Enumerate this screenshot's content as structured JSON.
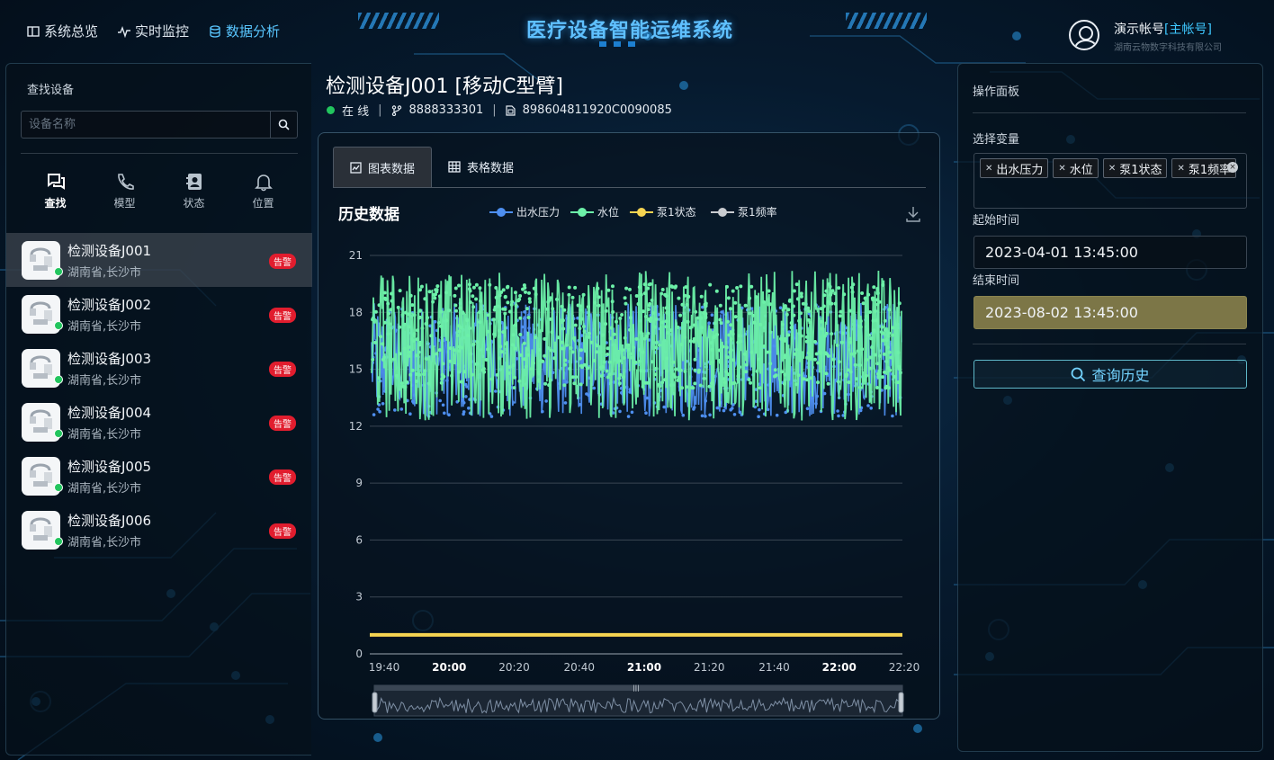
{
  "header": {
    "nav": [
      {
        "label": "系统总览",
        "icon": "layout-icon"
      },
      {
        "label": "实时监控",
        "icon": "pulse-icon"
      },
      {
        "label": "数据分析",
        "icon": "database-icon"
      }
    ],
    "app_title": "医疗设备智能运维系统",
    "user": {
      "name": "演示帐号",
      "role": "[主帐号]",
      "org": "湖南云物数字科技有限公司"
    }
  },
  "sidebar": {
    "title": "查找设备",
    "search_placeholder": "设备名称",
    "modes": [
      {
        "label": "查找",
        "icon": "chat-icon"
      },
      {
        "label": "模型",
        "icon": "phone-icon"
      },
      {
        "label": "状态",
        "icon": "contact-card-icon"
      },
      {
        "label": "位置",
        "icon": "bell-icon"
      }
    ],
    "devices": [
      {
        "name": "检测设备J001",
        "location": "湖南省,长沙市",
        "badge": "告警",
        "status": "online"
      },
      {
        "name": "检测设备J002",
        "location": "湖南省,长沙市",
        "badge": "告警",
        "status": "online"
      },
      {
        "name": "检测设备J003",
        "location": "湖南省,长沙市",
        "badge": "告警",
        "status": "online"
      },
      {
        "name": "检测设备J004",
        "location": "湖南省,长沙市",
        "badge": "告警",
        "status": "online"
      },
      {
        "name": "检测设备J005",
        "location": "湖南省,长沙市",
        "badge": "告警",
        "status": "online"
      },
      {
        "name": "检测设备J006",
        "location": "湖南省,长沙市",
        "badge": "告警",
        "status": "online"
      }
    ]
  },
  "device": {
    "title": "检测设备J001 [移动C型臂]",
    "status": "在 线",
    "id": "8888333301",
    "iccid": "898604811920C0090085"
  },
  "tabs": [
    {
      "label": "图表数据",
      "icon": "line-chart-icon"
    },
    {
      "label": "表格数据",
      "icon": "table-icon"
    }
  ],
  "colors": {
    "accent": "#59c6ff",
    "online": "#22c55e",
    "alarm": "#e11d2e",
    "series_pressure": "#4e8ff0",
    "series_level": "#6cf0a8",
    "series_pump_state": "#f7d451",
    "series_pump_freq": "#c9ccd0"
  },
  "chart_data": {
    "type": "line",
    "title": "历史数据",
    "xlabel": "",
    "ylabel": "",
    "ylim": [
      0,
      21
    ],
    "y_ticks": [
      0,
      3,
      6,
      9,
      12,
      15,
      18,
      21
    ],
    "x_ticks": [
      {
        "label": "19:40",
        "bold": false
      },
      {
        "label": "20:00",
        "bold": true
      },
      {
        "label": "20:20",
        "bold": false
      },
      {
        "label": "20:40",
        "bold": false
      },
      {
        "label": "21:00",
        "bold": true
      },
      {
        "label": "21:20",
        "bold": false
      },
      {
        "label": "21:40",
        "bold": false
      },
      {
        "label": "22:00",
        "bold": true
      },
      {
        "label": "22:20",
        "bold": false
      }
    ],
    "grid": true,
    "legend_position": "top-center",
    "series": [
      {
        "name": "出水压力",
        "color": "#4e8ff0",
        "range": [
          12.5,
          18.5
        ]
      },
      {
        "name": "水位",
        "color": "#6cf0a8",
        "range": [
          12.3,
          20.2
        ]
      },
      {
        "name": "泵1状态",
        "color": "#f7d451",
        "value": 1
      },
      {
        "name": "泵1频率",
        "color": "#c9ccd0",
        "value": null
      }
    ]
  },
  "right_panel": {
    "title": "操作面板",
    "variables_label": "选择变量",
    "selected_variables": [
      "出水压力",
      "水位",
      "泵1状态",
      "泵1频率"
    ],
    "start_label": "起始时间",
    "start_value": "2023-04-01 13:45:00",
    "end_label": "结束时间",
    "end_value": "2023-08-02 13:45:00",
    "query_label": "查询历史"
  }
}
